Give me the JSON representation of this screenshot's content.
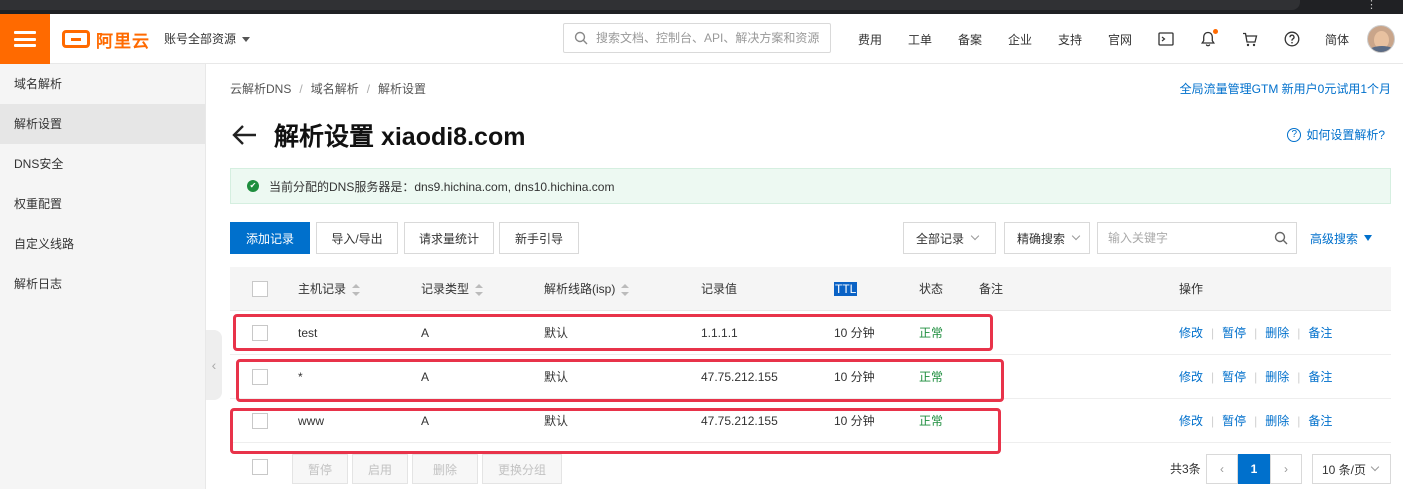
{
  "header": {
    "logo_text": "阿里云",
    "account_scope": "账号全部资源",
    "search_placeholder": "搜索文档、控制台、API、解决方案和资源",
    "nav": [
      "费用",
      "工单",
      "备案",
      "企业",
      "支持",
      "官网"
    ],
    "language": "简体",
    "accent_color": "#ff6a00"
  },
  "sidebar": {
    "items": [
      {
        "label": "域名解析",
        "active": false
      },
      {
        "label": "解析设置",
        "active": true
      },
      {
        "label": "DNS安全",
        "active": false
      },
      {
        "label": "权重配置",
        "active": false
      },
      {
        "label": "自定义线路",
        "active": false
      },
      {
        "label": "解析日志",
        "active": false
      }
    ]
  },
  "breadcrumb": [
    "云解析DNS",
    "域名解析",
    "解析设置"
  ],
  "promo_link": "全局流量管理GTM 新用户0元试用1个月",
  "page_title": "解析设置 xiaodi8.com",
  "help_link": "如何设置解析?",
  "dns_notice": "当前分配的DNS服务器是：dns9.hichina.com, dns10.hichina.com",
  "toolbar": {
    "add_record": "添加记录",
    "import_export": "导入/导出",
    "request_stats": "请求量统计",
    "newbie_guide": "新手引导",
    "record_filter": "全部记录",
    "search_mode": "精确搜索",
    "keyword_placeholder": "输入关键字",
    "advanced_search": "高级搜索"
  },
  "table": {
    "columns": {
      "host": "主机记录",
      "type": "记录类型",
      "line": "解析线路(isp)",
      "value": "记录值",
      "ttl": "TTL",
      "status": "状态",
      "remark": "备注",
      "actions": "操作"
    },
    "rows": [
      {
        "host": "test",
        "type": "A",
        "line": "默认",
        "value": "1.1.1.1",
        "ttl": "10 分钟",
        "status": "正常"
      },
      {
        "host": "*",
        "type": "A",
        "line": "默认",
        "value": "47.75.212.155",
        "ttl": "10 分钟",
        "status": "正常"
      },
      {
        "host": "www",
        "type": "A",
        "line": "默认",
        "value": "47.75.212.155",
        "ttl": "10 分钟",
        "status": "正常"
      }
    ],
    "row_actions": {
      "edit": "修改",
      "pause": "暂停",
      "delete": "删除",
      "remark": "备注"
    }
  },
  "footer": {
    "bulk_actions": [
      "暂停",
      "启用",
      "删除",
      "更换分组"
    ],
    "total": "共3条",
    "current_page": "1",
    "page_size": "10 条/页"
  },
  "colors": {
    "primary": "#0070cc",
    "status_ok": "#1e8e3e",
    "highlight_box": "#e8334a"
  }
}
